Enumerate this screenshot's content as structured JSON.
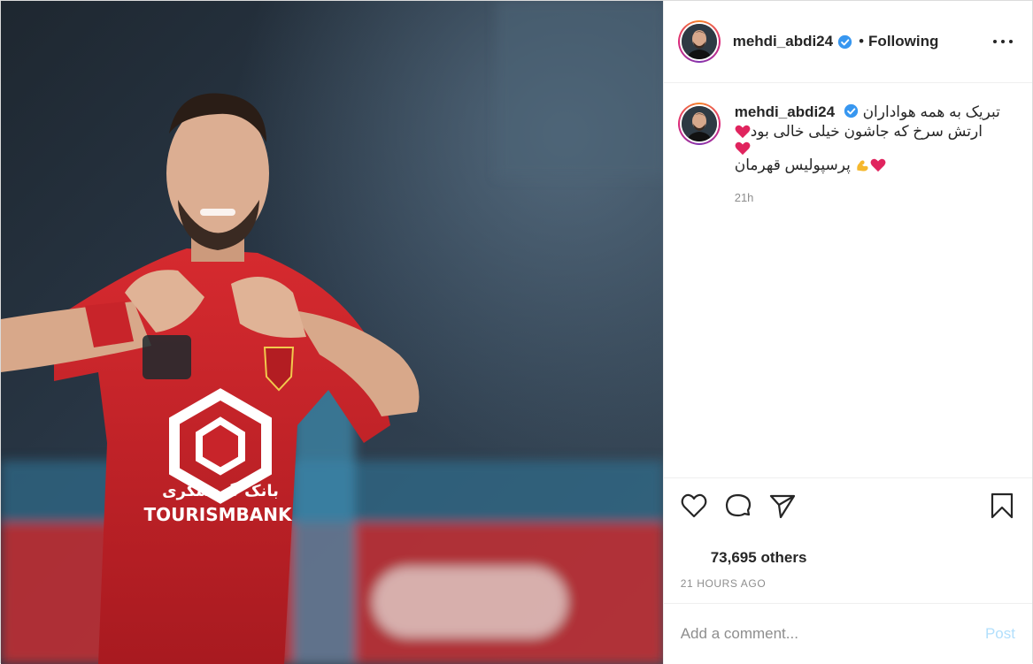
{
  "header": {
    "username": "mehdi_abdi24",
    "separator": "•",
    "follow_status": "Following",
    "avatar_icon": "profile-photo"
  },
  "caption": {
    "username": "mehdi_abdi24",
    "line1": "تبریک به همه هواداران",
    "line2": "ارتش سرخ که جاشون خیلی خالی بود",
    "line4": "پرسپولیس قهرمان",
    "time": "21h"
  },
  "photo": {
    "jersey_text": "TOURISMBANK",
    "jersey_text_fa": "بانک گردشگری"
  },
  "actions": {
    "like_icon": "heart-outline",
    "comment_icon": "speech-bubble",
    "share_icon": "paper-plane",
    "save_icon": "bookmark"
  },
  "likes": {
    "text": "73,695 others"
  },
  "timestamp": "21 HOURS AGO",
  "comment_box": {
    "placeholder": "Add a comment...",
    "post_label": "Post"
  },
  "colors": {
    "verified": "#3897f0",
    "post_button_disabled": "#b2dffc",
    "heart": "#e0245e",
    "jersey": "#c8242a"
  }
}
